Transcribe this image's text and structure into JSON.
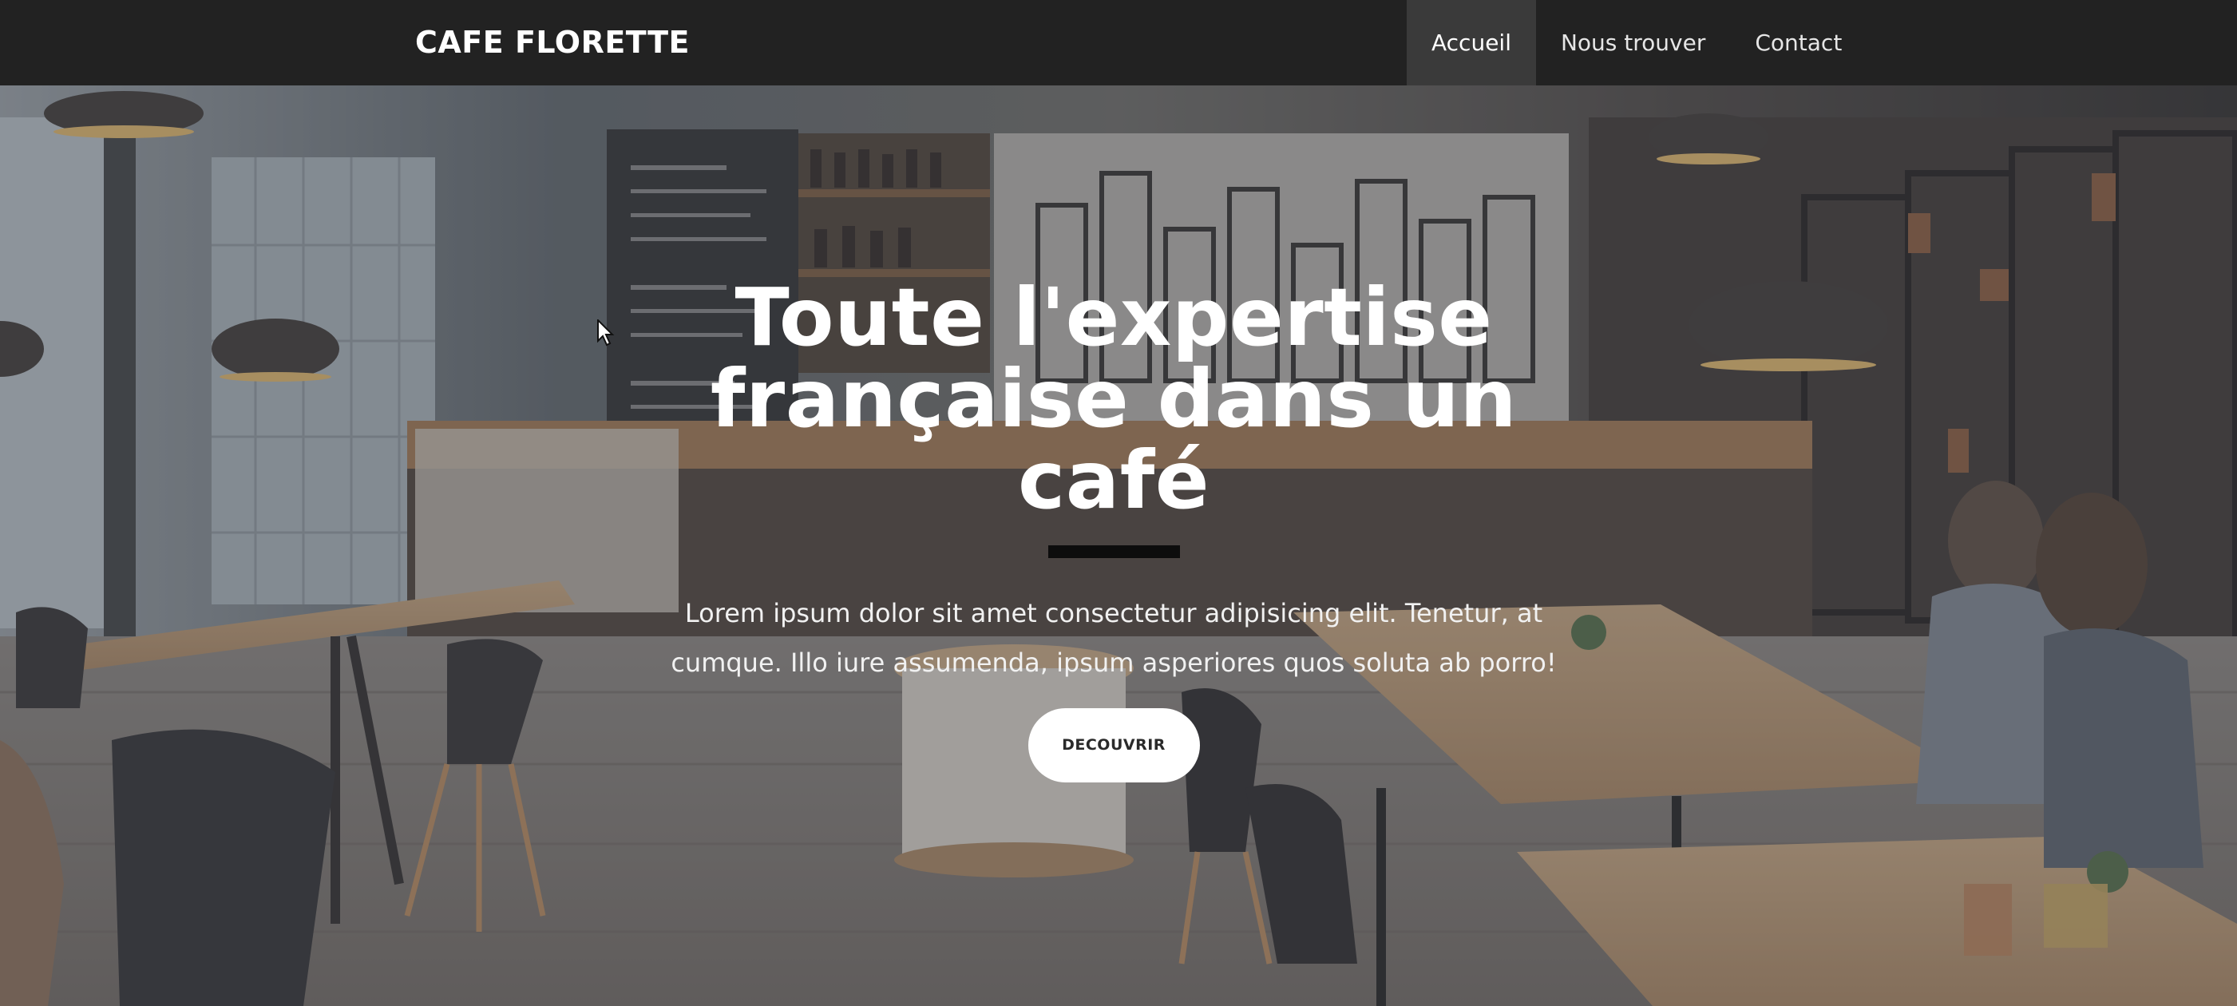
{
  "navbar": {
    "brand": "CAFE FLORETTE",
    "links": [
      {
        "label": "Accueil",
        "active": true
      },
      {
        "label": "Nous trouver",
        "active": false
      },
      {
        "label": "Contact",
        "active": false
      }
    ]
  },
  "hero": {
    "title_line1": "Toute l'expertise",
    "title_line2": "française dans un café",
    "text_line1": "Lorem ipsum dolor sit amet consectetur adipisicing elit. Tenetur, at",
    "text_line2": "cumque. Illo iure assumenda, ipsum asperiores quos soluta ab porro!",
    "cta_label": "DECOUVRIR",
    "background": "cafe-interior-photo"
  },
  "colors": {
    "navbar_bg": "#222222",
    "nav_active_bg": "#3a3a3a",
    "title_text": "#ffffff",
    "divider": "#0d0d0d",
    "cta_bg": "#ffffff"
  }
}
